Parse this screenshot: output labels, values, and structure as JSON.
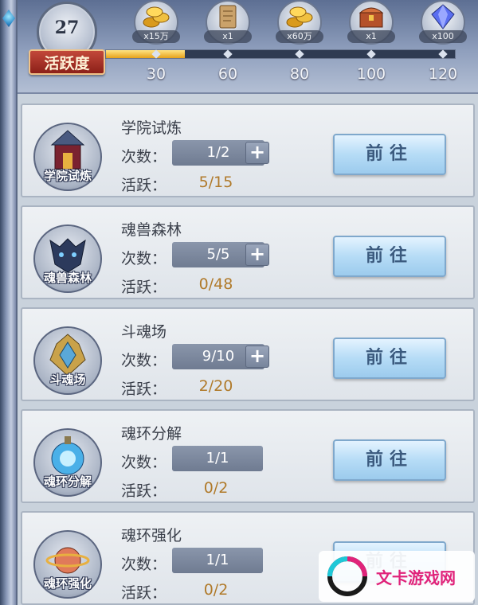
{
  "header": {
    "level": "27",
    "activity_label": "活跃度",
    "progress": {
      "current": 27,
      "max": 120,
      "fraction": 0.225
    },
    "rewards": [
      {
        "icon": "gold-coins-icon",
        "count": "x15万",
        "milestone": "30"
      },
      {
        "icon": "scroll-icon",
        "count": "x1",
        "milestone": "60"
      },
      {
        "icon": "gold-coins-icon",
        "count": "x60万",
        "milestone": "80"
      },
      {
        "icon": "treasure-chest-icon",
        "count": "x1",
        "milestone": "100"
      },
      {
        "icon": "crystal-gem-icon",
        "count": "x100",
        "milestone": "120"
      }
    ]
  },
  "labels": {
    "count": "次数：",
    "active": "活跃：",
    "go": "前往"
  },
  "tasks": [
    {
      "title": "学院试炼",
      "icon_caption": "学院试炼",
      "icon": "academy-gate-icon",
      "count": "1/2",
      "has_plus": true,
      "active": "5/15"
    },
    {
      "title": "魂兽森林",
      "icon_caption": "魂兽森林",
      "icon": "beast-head-icon",
      "count": "5/5",
      "has_plus": true,
      "active": "0/48"
    },
    {
      "title": "斗魂场",
      "icon_caption": "斗魂场",
      "icon": "arena-crest-icon",
      "count": "9/10",
      "has_plus": true,
      "active": "2/20"
    },
    {
      "title": "魂环分解",
      "icon_caption": "魂环分解",
      "icon": "soul-ring-orb-icon",
      "count": "1/1",
      "has_plus": false,
      "active": "0/2"
    },
    {
      "title": "魂环强化",
      "icon_caption": "魂环强化",
      "icon": "soul-ring-planet-icon",
      "count": "1/1",
      "has_plus": false,
      "active": "0/2"
    }
  ],
  "watermark": {
    "text": "文卡游戏网"
  },
  "colors": {
    "active_value": "#b07a2a",
    "go_button": "#b6dcf6",
    "activity_badge": "#c2483a",
    "progress_fill": "#e6a11a"
  }
}
